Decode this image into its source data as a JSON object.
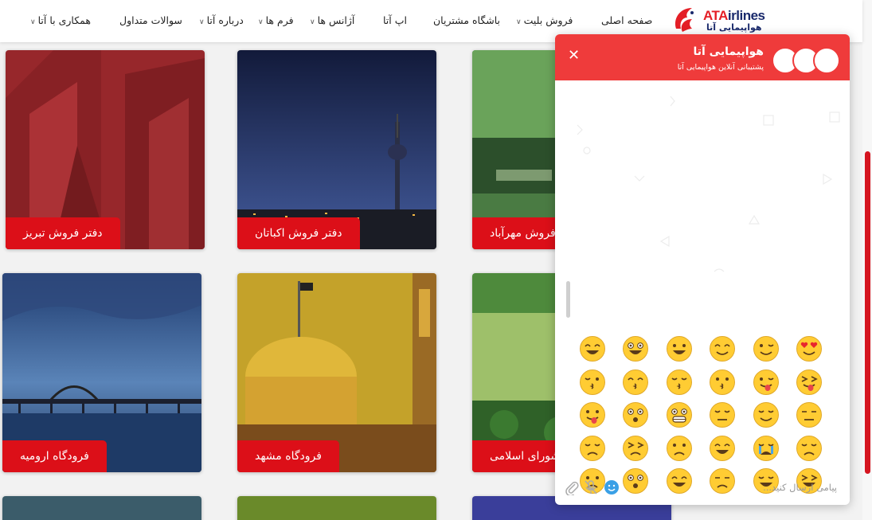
{
  "brand": {
    "logo_en": "ATA",
    "logo_en_rest": "irlines",
    "logo_fa": "هواپیمایی آتا",
    "colors": {
      "primary": "#dc0f18",
      "chat_header": "#ef3b3b",
      "navy": "#1a2a6c"
    }
  },
  "nav": {
    "items": [
      {
        "label": "صفحه اصلی",
        "dropdown": false
      },
      {
        "label": "فروش بلیت",
        "dropdown": true
      },
      {
        "label": "باشگاه مشتریان",
        "dropdown": false
      },
      {
        "label": "اپ آتا",
        "dropdown": false
      },
      {
        "label": "آژانس ها",
        "dropdown": true
      },
      {
        "label": "فرم ها",
        "dropdown": true
      },
      {
        "label": "درباره آتا",
        "dropdown": true
      },
      {
        "label": "سوالات متداول",
        "dropdown": false
      },
      {
        "label": "همکاری با آتا",
        "dropdown": true
      }
    ]
  },
  "cards": [
    {
      "label": "دفتر فروش تبریز"
    },
    {
      "label": "دفتر فروش اکباتان"
    },
    {
      "label": "فروش مهرآباد"
    },
    {
      "label": "فرودگاه ارومیه"
    },
    {
      "label": "فرودگاه مشهد"
    },
    {
      "label": "شورای اسلامی"
    }
  ],
  "chat": {
    "title": "هواپیمایی آتا",
    "subtitle": "پشتیبانی آنلاین هواپیمایی آتا",
    "close_icon": "close-icon",
    "input_placeholder": "پیامی ارسال کنید...",
    "emoji_picker_icon": "smile-icon",
    "mic_icon": "mic-off-icon",
    "attach_icon": "paperclip-icon",
    "emojis": [
      "heart-eyes",
      "wink",
      "smile",
      "grin",
      "smiley",
      "big-grin",
      "squint-tongue",
      "wink-tongue",
      "kissing",
      "kissing-closed",
      "kissing-smile",
      "blow-kiss",
      "unamused",
      "relieved",
      "pensive",
      "grimacing",
      "flushed",
      "tongue-out",
      "sleepy",
      "sob",
      "joy",
      "cry",
      "confounded",
      "disappointed",
      "tired",
      "weary",
      "downcast",
      "sweat-smile",
      "fearful",
      "sad-sweat"
    ]
  }
}
